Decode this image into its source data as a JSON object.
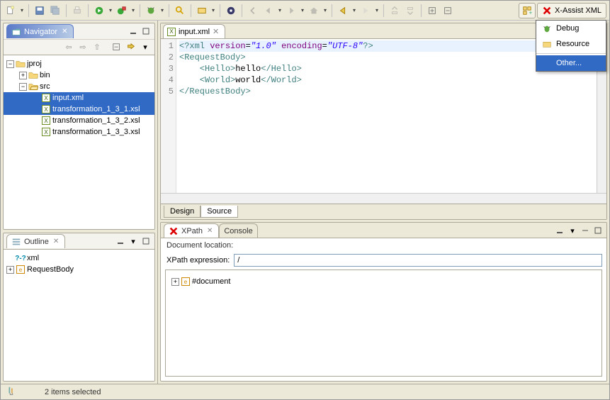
{
  "toolbar_icons": [
    "new-wizard",
    "save",
    "save-all",
    "print",
    "run",
    "run-external",
    "debug",
    "search",
    "box",
    "eclipse",
    "nav-back",
    "nav-forward",
    "nav-up",
    "nav-home",
    "arrow-left",
    "arrow-right",
    "step-out",
    "step-return",
    "plus",
    "minus"
  ],
  "perspective": {
    "active": "X-Assist XML",
    "menu": [
      {
        "icon": "bug-icon",
        "label": "Debug"
      },
      {
        "icon": "folder-icon",
        "label": "Resource"
      },
      {
        "icon": "",
        "label": "Other...",
        "selected": true
      }
    ]
  },
  "navigator": {
    "title": "Navigator",
    "tree": [
      {
        "depth": 0,
        "tw": "-",
        "icon": "folder",
        "label": "jproj"
      },
      {
        "depth": 1,
        "tw": "+",
        "icon": "folder",
        "label": "bin"
      },
      {
        "depth": 1,
        "tw": "-",
        "icon": "folder-open",
        "label": "src"
      },
      {
        "depth": 2,
        "tw": "",
        "icon": "xml",
        "label": "input.xml",
        "selected": true
      },
      {
        "depth": 2,
        "tw": "",
        "icon": "xml",
        "label": "transformation_1_3_1.xsl",
        "selected": true
      },
      {
        "depth": 2,
        "tw": "",
        "icon": "xml",
        "label": "transformation_1_3_2.xsl"
      },
      {
        "depth": 2,
        "tw": "",
        "icon": "xml",
        "label": "transformation_1_3_3.xsl"
      }
    ]
  },
  "outline": {
    "title": "Outline",
    "tree": [
      {
        "depth": 0,
        "tw": "",
        "icon": "pi",
        "label": "xml"
      },
      {
        "depth": 0,
        "tw": "+",
        "icon": "elem",
        "label": "RequestBody"
      }
    ]
  },
  "editor": {
    "tab_label": "input.xml",
    "bottom_tabs": {
      "design": "Design",
      "source": "Source"
    },
    "gutter": [
      "1",
      "2",
      "3",
      "4",
      "5"
    ],
    "chart_data": null,
    "lines_html": [
      "<span class='t-tag'>&lt;?xml</span> <span class='t-attr'>version</span>=<span class='t-str'>\"1.0\"</span> <span class='t-attr'>encoding</span>=<span class='t-str'>\"UTF-8\"</span><span class='t-tag'>?&gt;</span>",
      "<span class='t-tag'>&lt;RequestBody&gt;</span>",
      "    <span class='t-tag'>&lt;Hello&gt;</span><span class='t-txt'>hello</span><span class='t-tag'>&lt;/Hello&gt;</span>",
      "    <span class='t-tag'>&lt;World&gt;</span><span class='t-txt'>world</span><span class='t-tag'>&lt;/World&gt;</span>",
      "<span class='t-tag'>&lt;/RequestBody&gt;</span>"
    ]
  },
  "xpath": {
    "tab1": "XPath",
    "tab2": "Console",
    "doc_location_label": "Document location:",
    "expr_label": "XPath expression:",
    "expr_value": "/",
    "result_tree": [
      {
        "depth": 0,
        "tw": "+",
        "icon": "elem",
        "label": "#document"
      }
    ]
  },
  "statusbar": {
    "msg": "2 items selected"
  }
}
